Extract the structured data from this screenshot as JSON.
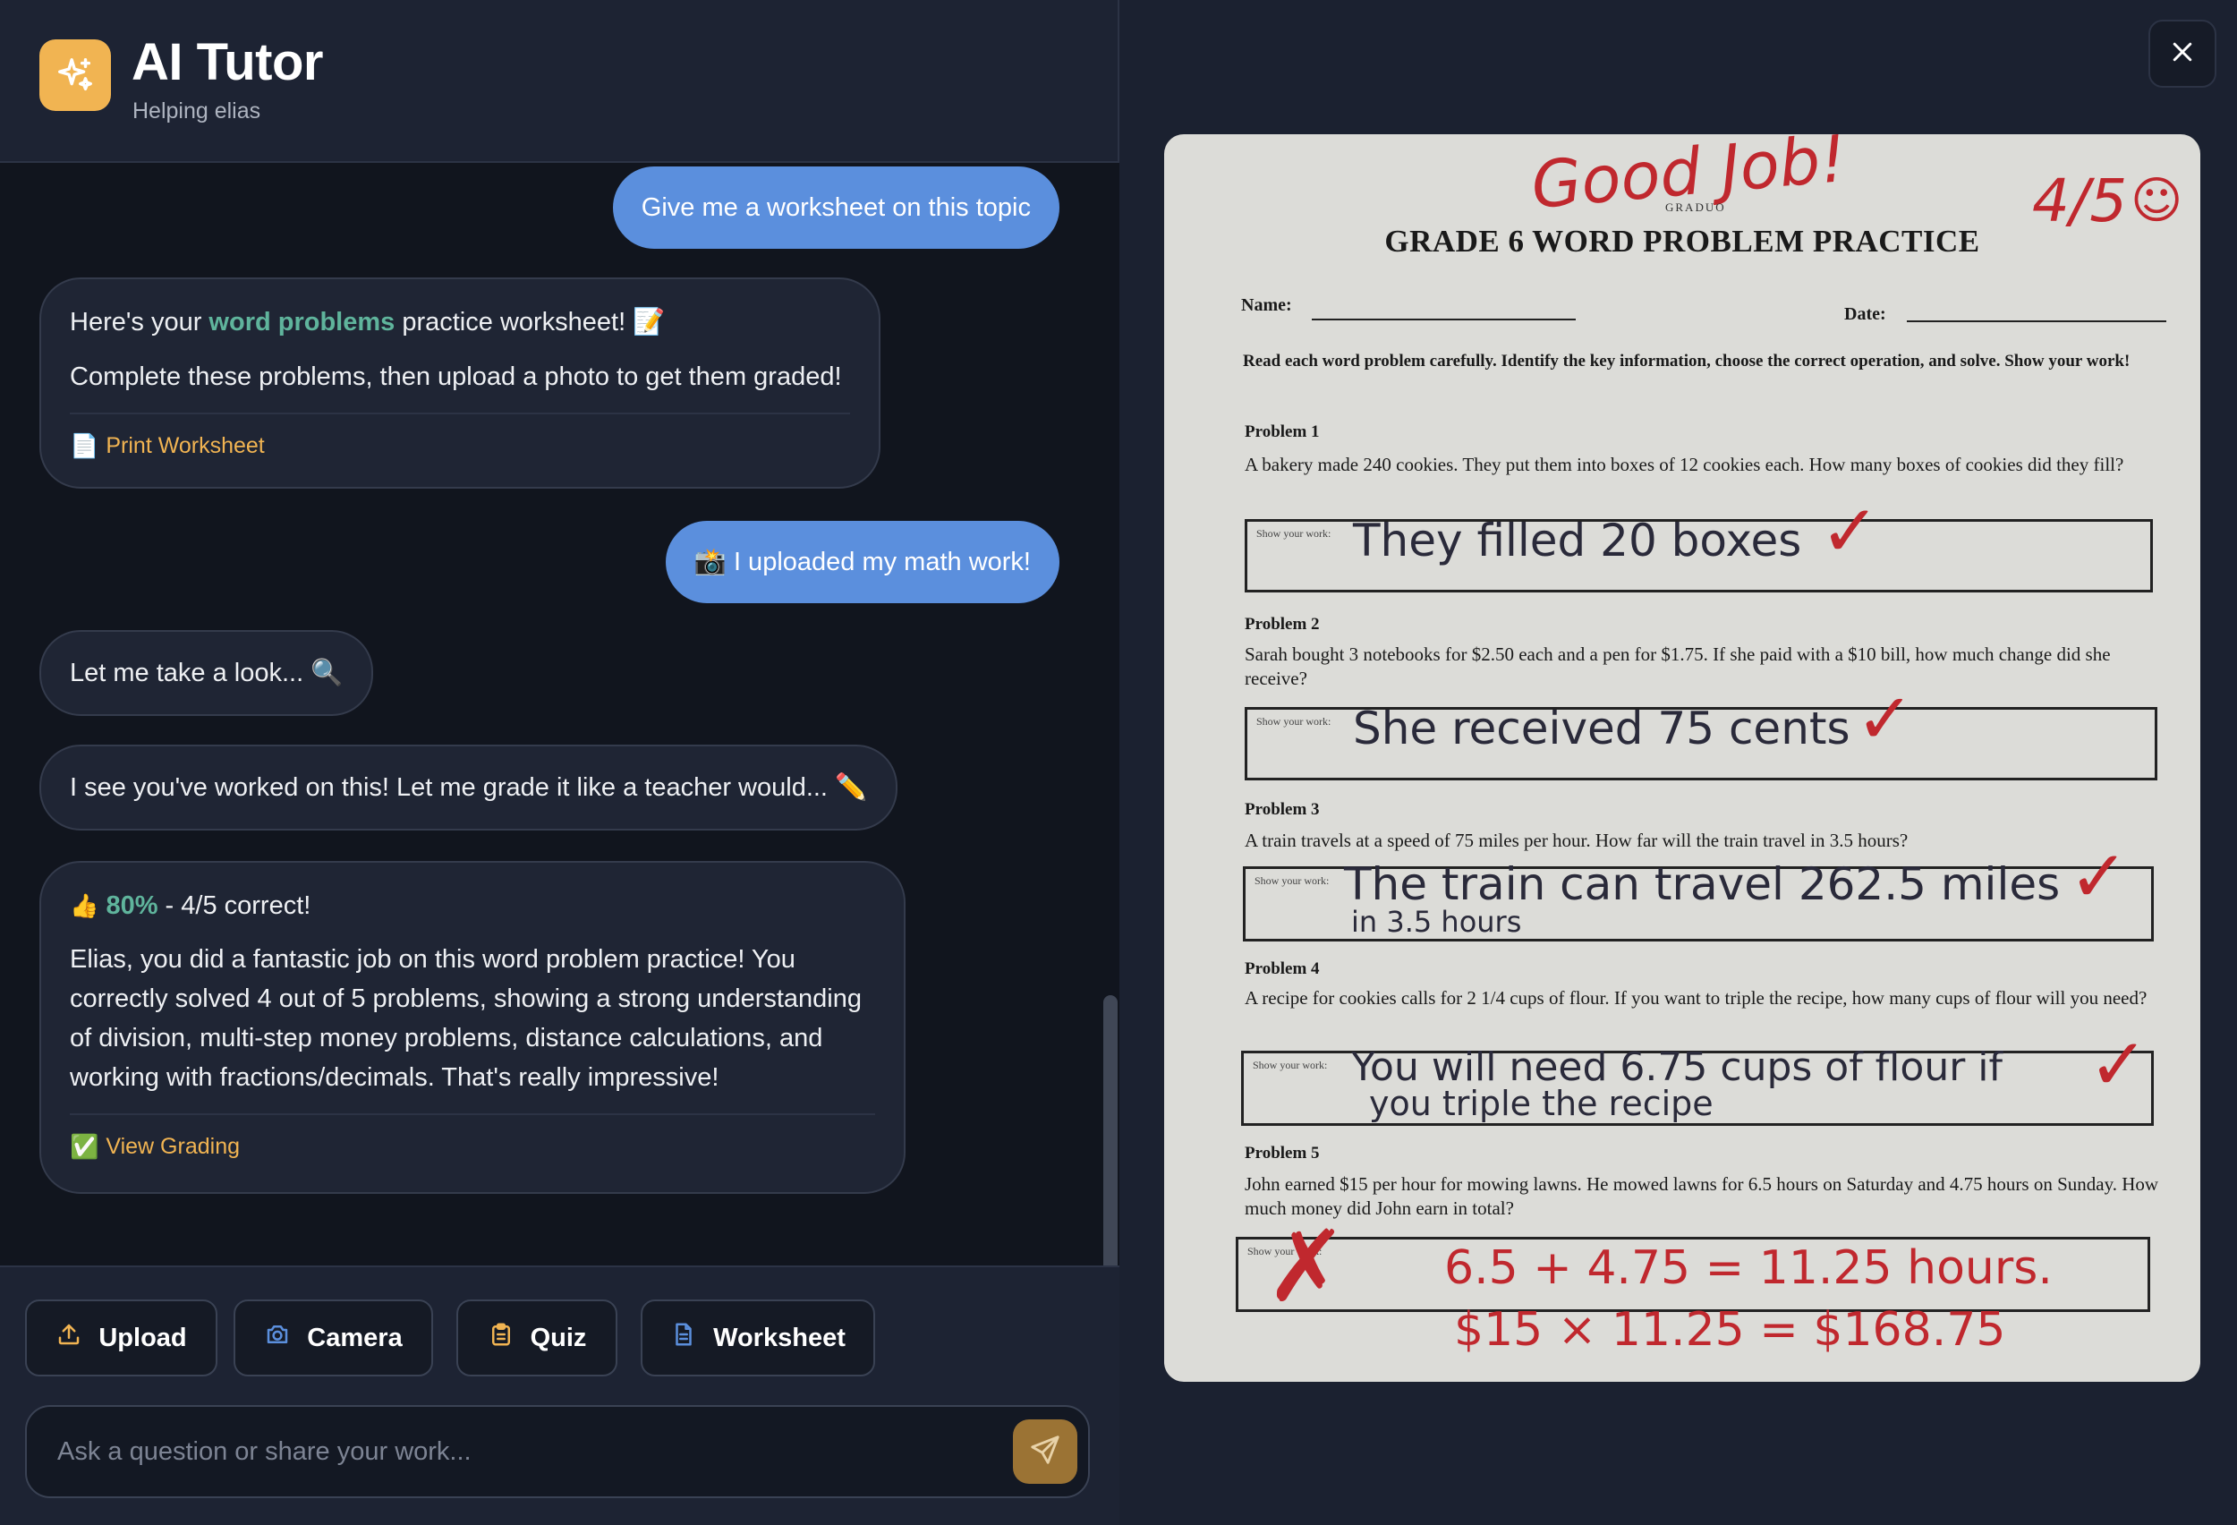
{
  "app": {
    "title": "AI Tutor",
    "subtitle": "Helping elias"
  },
  "chat": {
    "msg1_user": "Give me a worksheet on this topic",
    "msg2_ai": {
      "prefix": "Here's your ",
      "highlight": "word problems",
      "suffix": " practice worksheet! 📝",
      "line2": "Complete these problems, then upload a photo to get them graded!",
      "link_icon": "📄",
      "link_label": "Print Worksheet"
    },
    "msg3_user": "📸 I uploaded my math work!",
    "msg4_ai": "Let me take a look... 🔍",
    "msg5_ai": "I see you've worked on this! Let me grade it like a teacher would... ✏️",
    "msg6_ai": {
      "score_emoji": "👍",
      "score_pct": "80%",
      "score_rest": " - 4/5 correct!",
      "body": "Elias, you did a fantastic job on this word problem practice! You correctly solved 4 out of 5 problems, showing a strong understanding of division, multi-step money problems, distance calculations, and working with fractions/decimals. That's really impressive!",
      "link_icon": "✅",
      "link_label": "View Grading"
    }
  },
  "toolbar": {
    "upload_label": "Upload",
    "camera_label": "Camera",
    "quiz_label": "Quiz",
    "worksheet_label": "Worksheet",
    "input_placeholder": "Ask a question or share your work..."
  },
  "icons": {
    "logo": "sparkles-icon",
    "upload": "upload-icon",
    "camera": "camera-icon",
    "quiz": "clipboard-icon",
    "worksheet": "document-icon",
    "send": "send-icon",
    "close": "close-icon"
  },
  "colors": {
    "accent": "#f1b452",
    "user_bubble": "#5b8fdd",
    "highlight_green": "#5fb49c",
    "grading_red": "#c0282e"
  },
  "worksheet": {
    "header_small": "GRADUO",
    "title": "GRADE 6 WORD PROBLEM PRACTICE",
    "name_label": "Name:",
    "date_label": "Date:",
    "instructions": "Read each word problem carefully. Identify the key information, choose the correct operation, and solve. Show your work!",
    "work_label": "Show your work:",
    "good_job": "Good Job!",
    "score": "4/5",
    "smiley": "☺",
    "problems": [
      {
        "label": "Problem 1",
        "text": "A bakery made 240 cookies. They put them into boxes of 12 cookies each. How many boxes of cookies did they fill?",
        "answer": "They filled 20 boxes",
        "mark": "✓"
      },
      {
        "label": "Problem 2",
        "text": "Sarah bought 3 notebooks for $2.50 each and a pen for $1.75. If she paid with a $10 bill, how much change did she receive?",
        "answer": "She received 75 cents",
        "mark": "✓"
      },
      {
        "label": "Problem 3",
        "text": "A train travels at a speed of 75 miles per hour. How far will the train travel in 3.5 hours?",
        "answer": "The train can travel 262.5 miles",
        "answer2": "in 3.5 hours",
        "mark": "✓"
      },
      {
        "label": "Problem 4",
        "text": "A recipe for cookies calls for 2 1/4 cups of flour. If you want to triple the recipe, how many cups of flour will you need?",
        "answer": "You will need 6.75 cups of flour if",
        "answer2": "you triple the recipe",
        "mark": "✓"
      },
      {
        "label": "Problem 5",
        "text": "John earned $15 per hour for mowing lawns. He mowed lawns for 6.5 hours on Saturday and 4.75 hours on Sunday. How much money did John earn in total?",
        "mark": "✗",
        "correction1": "6.5 + 4.75 = 11.25 hours.",
        "correction2": "$15 × 11.25 = $168.75"
      }
    ]
  }
}
